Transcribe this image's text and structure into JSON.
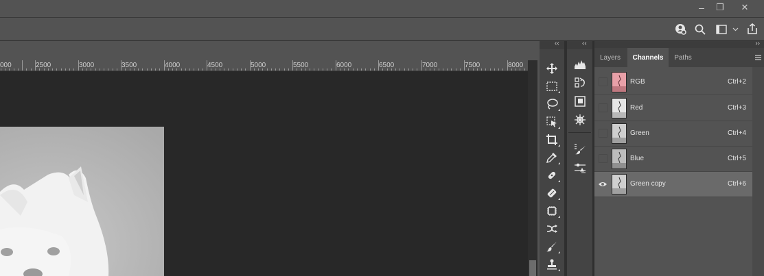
{
  "window_controls": {
    "minimize": "–",
    "restore": "❐",
    "close": "✕"
  },
  "options_bar": {
    "icons": [
      "account-search-icon",
      "search-icon",
      "workspace-icon",
      "chevron-down-icon",
      "share-icon"
    ]
  },
  "ruler": {
    "labels": [
      "000",
      "2500",
      "3000",
      "3500",
      "4000",
      "4500",
      "5000",
      "5500",
      "6000",
      "6500",
      "7000",
      "7500",
      "8000"
    ]
  },
  "panel": {
    "collapse_left": "‹‹",
    "collapse_right": "››",
    "tabs": [
      {
        "label": "Layers",
        "active": false
      },
      {
        "label": "Channels",
        "active": true
      },
      {
        "label": "Paths",
        "active": false
      }
    ],
    "channels": [
      {
        "name": "RGB",
        "shortcut": "Ctrl+2",
        "visible": false,
        "thumb": "pink"
      },
      {
        "name": "Red",
        "shortcut": "Ctrl+3",
        "visible": false,
        "thumb": "gray"
      },
      {
        "name": "Green",
        "shortcut": "Ctrl+4",
        "visible": false,
        "thumb": "gray"
      },
      {
        "name": "Blue",
        "shortcut": "Ctrl+5",
        "visible": false,
        "thumb": "gray"
      },
      {
        "name": "Green copy",
        "shortcut": "Ctrl+6",
        "visible": true,
        "selected": true,
        "thumb": "gray"
      }
    ]
  },
  "toolbar": {
    "tools": [
      "move-icon",
      "marquee-icon",
      "lasso-icon",
      "object-select-icon",
      "crop-icon",
      "eyedropper-icon",
      "healing-icon",
      "patch-icon",
      "content-aware-icon",
      "red-eye-icon",
      "brush-icon",
      "stamp-icon"
    ]
  },
  "colors": {
    "bg": "#535353",
    "canvas": "#282828",
    "panel_dark": "#444444",
    "selected_row": "#6a6a6a"
  }
}
